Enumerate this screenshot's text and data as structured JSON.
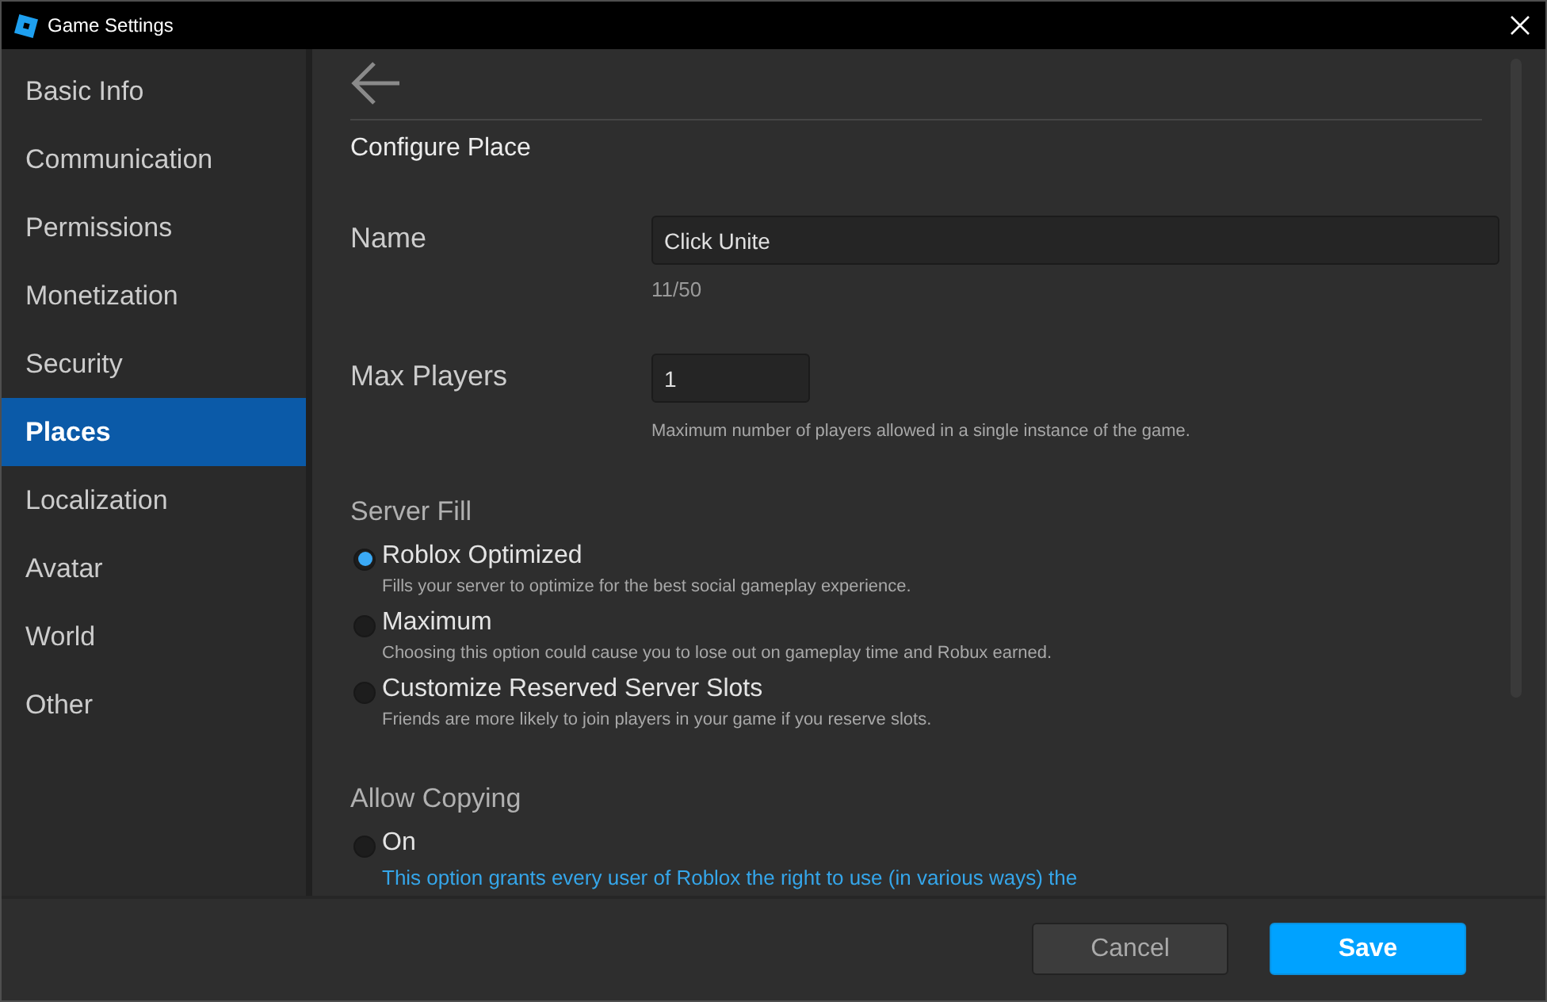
{
  "window": {
    "title": "Game Settings"
  },
  "sidebar": {
    "items": [
      {
        "label": "Basic Info",
        "selected": false
      },
      {
        "label": "Communication",
        "selected": false
      },
      {
        "label": "Permissions",
        "selected": false
      },
      {
        "label": "Monetization",
        "selected": false
      },
      {
        "label": "Security",
        "selected": false
      },
      {
        "label": "Places",
        "selected": true
      },
      {
        "label": "Localization",
        "selected": false
      },
      {
        "label": "Avatar",
        "selected": false
      },
      {
        "label": "World",
        "selected": false
      },
      {
        "label": "Other",
        "selected": false
      }
    ]
  },
  "page": {
    "title": "Configure Place"
  },
  "fields": [
    {
      "label": "Name",
      "kind": "text",
      "value": "Click Unite",
      "counter": "11/50"
    },
    {
      "label": "Max Players",
      "kind": "number",
      "value": "1",
      "hint": "Maximum number of players allowed in a single instance of the game."
    }
  ],
  "server_fill": {
    "heading": "Server Fill",
    "options": [
      {
        "label": "Roblox Optimized",
        "description": "Fills your server to optimize for the best social gameplay experience.",
        "selected": true
      },
      {
        "label": "Maximum",
        "description": "Choosing this option could cause you to lose out on gameplay time and Robux earned.",
        "selected": false
      },
      {
        "label": "Customize Reserved Server Slots",
        "description": "Friends are more likely to join players in your game if you reserve slots.",
        "selected": false
      }
    ]
  },
  "allow_copying": {
    "heading": "Allow Copying",
    "options": [
      {
        "label": "On",
        "warning": "This option grants every user of Roblox the right to use (in various ways) the",
        "selected": false
      }
    ]
  },
  "buttons": [
    {
      "label": "Cancel",
      "kind": "secondary"
    },
    {
      "label": "Save",
      "kind": "primary"
    }
  ]
}
